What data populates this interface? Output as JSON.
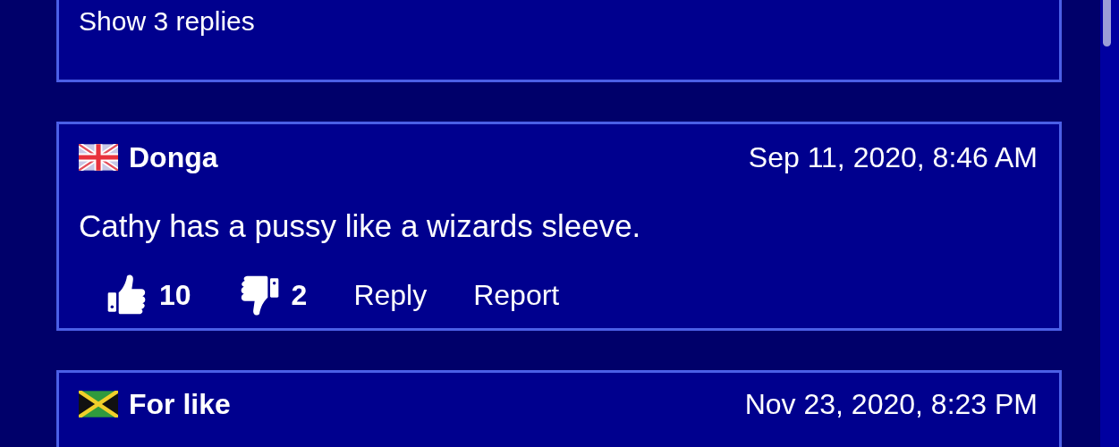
{
  "comments": [
    {
      "kind": "replies_only",
      "replies_link": "Show 3 replies"
    },
    {
      "kind": "full",
      "flag": {
        "kind": "gb"
      },
      "author": "Donga",
      "date": "Sep 11, 2020, 8:46 AM",
      "text": "Cathy has a pussy like a wizards sleeve.",
      "likes": "10",
      "dislikes": "2",
      "actions": [
        "Reply",
        "Report"
      ]
    },
    {
      "kind": "header_only",
      "flag": {
        "kind": "jm"
      },
      "author": "For like",
      "date": "Nov 23, 2020, 8:23 PM"
    }
  ]
}
